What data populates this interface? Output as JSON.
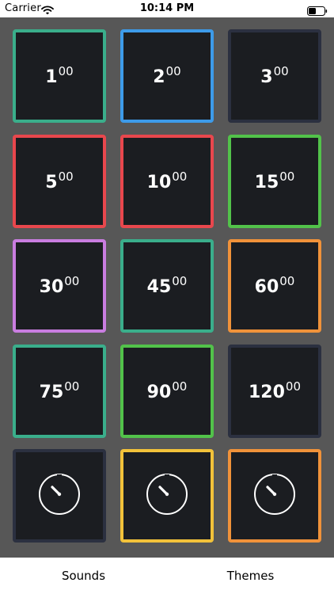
{
  "status_bar": {
    "carrier": "Carrier",
    "time": "10:14 PM",
    "wifi_icon": "wifi-icon",
    "battery_icon": "battery-icon"
  },
  "timers": [
    {
      "minutes": "1",
      "seconds": "00",
      "border_color": "#3aae8b"
    },
    {
      "minutes": "2",
      "seconds": "00",
      "border_color": "#3d9be9"
    },
    {
      "minutes": "3",
      "seconds": "00",
      "border_color": "#2b3040"
    },
    {
      "minutes": "5",
      "seconds": "00",
      "border_color": "#e8474d"
    },
    {
      "minutes": "10",
      "seconds": "00",
      "border_color": "#e8474d"
    },
    {
      "minutes": "15",
      "seconds": "00",
      "border_color": "#52c24a"
    },
    {
      "minutes": "30",
      "seconds": "00",
      "border_color": "#c97de0"
    },
    {
      "minutes": "45",
      "seconds": "00",
      "border_color": "#3aae8b"
    },
    {
      "minutes": "60",
      "seconds": "00",
      "border_color": "#f0923a"
    },
    {
      "minutes": "75",
      "seconds": "00",
      "border_color": "#3aae8b"
    },
    {
      "minutes": "90",
      "seconds": "00",
      "border_color": "#52c24a"
    },
    {
      "minutes": "120",
      "seconds": "00",
      "border_color": "#2b3040"
    }
  ],
  "custom_timers": [
    {
      "icon": "stopwatch-icon",
      "border_color": "#2b3040"
    },
    {
      "icon": "stopwatch-icon",
      "border_color": "#f2c23a"
    },
    {
      "icon": "stopwatch-icon",
      "border_color": "#f0923a"
    }
  ],
  "tab_bar": {
    "sounds_label": "Sounds",
    "themes_label": "Themes"
  },
  "colors": {
    "background": "#575757",
    "tile_fill": "#1b1d21",
    "text": "#ffffff"
  }
}
